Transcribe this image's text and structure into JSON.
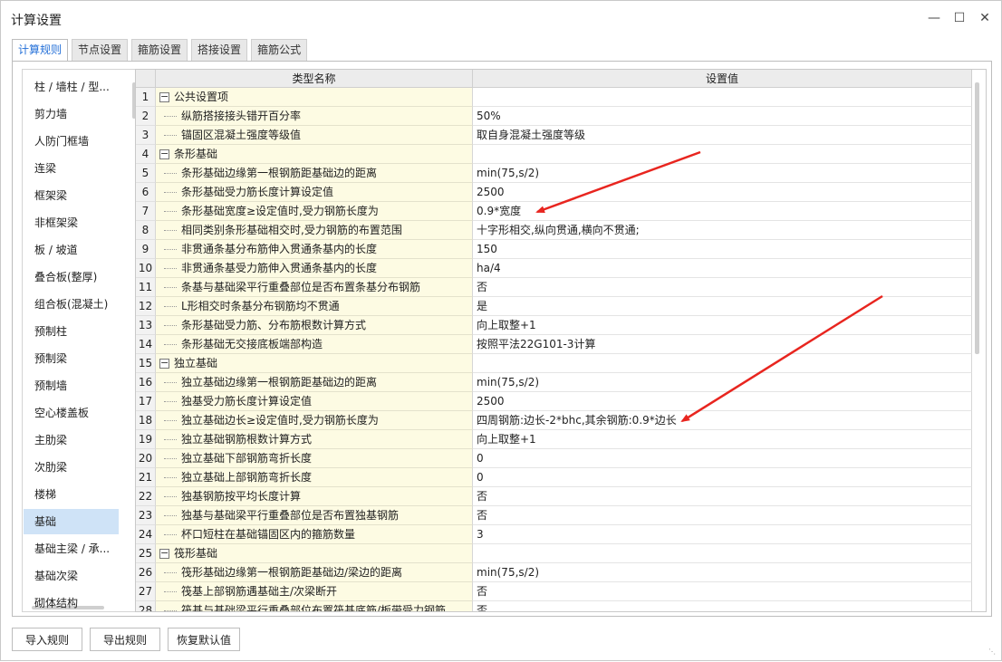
{
  "window": {
    "title": "计算设置"
  },
  "tabs": [
    {
      "label": "计算规则"
    },
    {
      "label": "节点设置"
    },
    {
      "label": "箍筋设置"
    },
    {
      "label": "搭接设置"
    },
    {
      "label": "箍筋公式"
    }
  ],
  "sidebar": {
    "items": [
      {
        "label": "柱 / 墙柱 / 型..."
      },
      {
        "label": "剪力墙"
      },
      {
        "label": "人防门框墙"
      },
      {
        "label": "连梁"
      },
      {
        "label": "框架梁"
      },
      {
        "label": "非框架梁"
      },
      {
        "label": "板 / 坡道"
      },
      {
        "label": "叠合板(整厚)"
      },
      {
        "label": "组合板(混凝土)"
      },
      {
        "label": "预制柱"
      },
      {
        "label": "预制梁"
      },
      {
        "label": "预制墙"
      },
      {
        "label": "空心楼盖板"
      },
      {
        "label": "主肋梁"
      },
      {
        "label": "次肋梁"
      },
      {
        "label": "楼梯"
      },
      {
        "label": "基础"
      },
      {
        "label": "基础主梁 / 承..."
      },
      {
        "label": "基础次梁"
      },
      {
        "label": "砌体结构"
      }
    ]
  },
  "grid": {
    "columns": {
      "num": "",
      "name": "类型名称",
      "value": "设置值"
    },
    "rows": [
      {
        "num": "1",
        "name": "公共设置项",
        "value": "",
        "group": true
      },
      {
        "num": "2",
        "name": "纵筋搭接接头错开百分率",
        "value": "50%"
      },
      {
        "num": "3",
        "name": "锚固区混凝土强度等级值",
        "value": "取自身混凝土强度等级"
      },
      {
        "num": "4",
        "name": "条形基础",
        "value": "",
        "group": true
      },
      {
        "num": "5",
        "name": "条形基础边缘第一根钢筋距基础边的距离",
        "value": "min(75,s/2)"
      },
      {
        "num": "6",
        "name": "条形基础受力筋长度计算设定值",
        "value": "2500"
      },
      {
        "num": "7",
        "name": "条形基础宽度≥设定值时,受力钢筋长度为",
        "value": "0.9*宽度"
      },
      {
        "num": "8",
        "name": "相同类别条形基础相交时,受力钢筋的布置范围",
        "value": "十字形相交,纵向贯通,横向不贯通;"
      },
      {
        "num": "9",
        "name": "非贯通条基分布筋伸入贯通条基内的长度",
        "value": "150"
      },
      {
        "num": "10",
        "name": "非贯通条基受力筋伸入贯通条基内的长度",
        "value": "ha/4"
      },
      {
        "num": "11",
        "name": "条基与基础梁平行重叠部位是否布置条基分布钢筋",
        "value": "否"
      },
      {
        "num": "12",
        "name": "L形相交时条基分布钢筋均不贯通",
        "value": "是"
      },
      {
        "num": "13",
        "name": "条形基础受力筋、分布筋根数计算方式",
        "value": "向上取整+1"
      },
      {
        "num": "14",
        "name": "条形基础无交接底板端部构造",
        "value": "按照平法22G101-3计算"
      },
      {
        "num": "15",
        "name": "独立基础",
        "value": "",
        "group": true
      },
      {
        "num": "16",
        "name": "独立基础边缘第一根钢筋距基础边的距离",
        "value": "min(75,s/2)"
      },
      {
        "num": "17",
        "name": "独基受力筋长度计算设定值",
        "value": "2500"
      },
      {
        "num": "18",
        "name": "独立基础边长≥设定值时,受力钢筋长度为",
        "value": "四周钢筋:边长-2*bhc,其余钢筋:0.9*边长"
      },
      {
        "num": "19",
        "name": "独立基础钢筋根数计算方式",
        "value": "向上取整+1"
      },
      {
        "num": "20",
        "name": "独立基础下部钢筋弯折长度",
        "value": "0"
      },
      {
        "num": "21",
        "name": "独立基础上部钢筋弯折长度",
        "value": "0"
      },
      {
        "num": "22",
        "name": "独基钢筋按平均长度计算",
        "value": "否"
      },
      {
        "num": "23",
        "name": "独基与基础梁平行重叠部位是否布置独基钢筋",
        "value": "否"
      },
      {
        "num": "24",
        "name": "杯口短柱在基础锚固区内的箍筋数量",
        "value": "3"
      },
      {
        "num": "25",
        "name": "筏形基础",
        "value": "",
        "group": true
      },
      {
        "num": "26",
        "name": "筏形基础边缘第一根钢筋距基础边/梁边的距离",
        "value": "min(75,s/2)"
      },
      {
        "num": "27",
        "name": "筏基上部钢筋遇基础主/次梁断开",
        "value": "否"
      },
      {
        "num": "28",
        "name": "筏基与基础梁平行重叠部位布置筏基底筋/板带受力钢筋",
        "value": "否"
      }
    ]
  },
  "buttons": {
    "import": "导入规则",
    "export": "导出规则",
    "restore": "恢复默认值"
  },
  "annotations": {
    "arrow_color": "#e8251f"
  }
}
